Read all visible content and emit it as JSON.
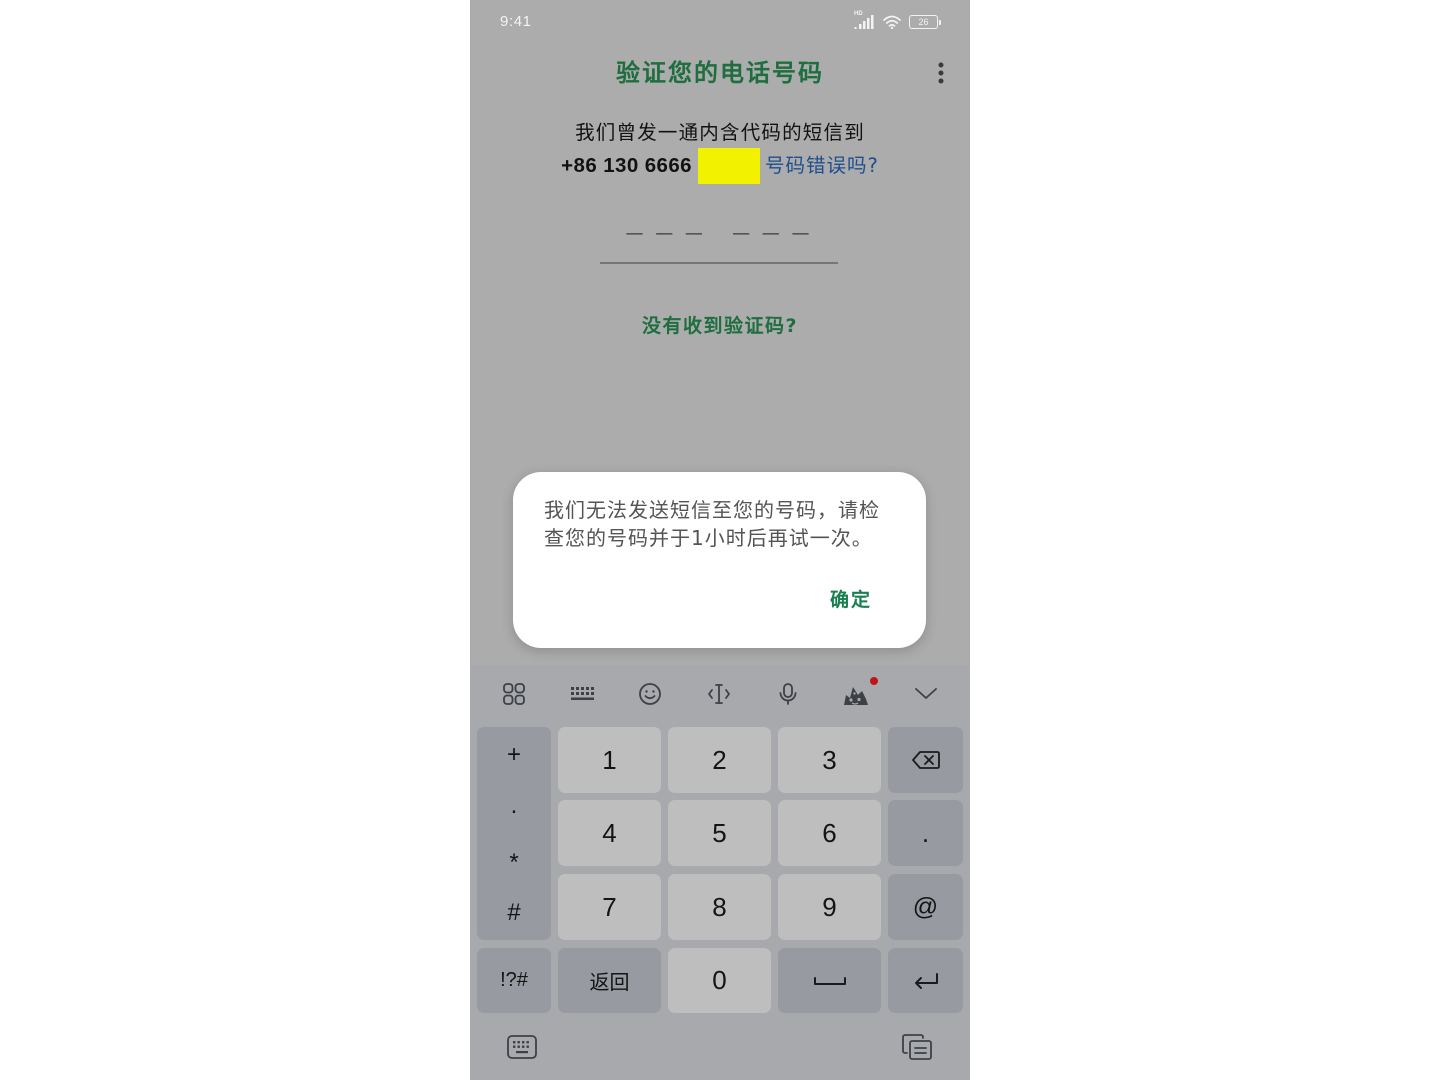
{
  "status_bar": {
    "time": "9:41",
    "network_label": "HD",
    "battery_level": "26",
    "icons": [
      "signal-icon",
      "wifi-icon",
      "battery-icon"
    ]
  },
  "header": {
    "title": "验证您的电话号码",
    "menu_icon": "more-vert-icon"
  },
  "verification": {
    "instruction": "我们曾发一通内含代码的短信到",
    "phone_number": "+86 130 6666",
    "wrong_number_link": "号码错误吗?",
    "code_placeholder": "— — —   — — —",
    "resend_link": "没有收到验证码?"
  },
  "dialog": {
    "message": "我们无法发送短信至您的号码，请检查您的号码并于1小时后再试一次。",
    "ok_label": "确定"
  },
  "keyboard": {
    "toolbar_icons": [
      "apps-grid-icon",
      "keyboard-layout-icon",
      "emoji-icon",
      "text-cursor-icon",
      "microphone-icon",
      "stickers-icon",
      "chevron-down-icon"
    ],
    "side_symbols": [
      "+",
      ".",
      "*",
      "#"
    ],
    "symbols_key": "!?#",
    "digits": [
      "1",
      "2",
      "3",
      "4",
      "5",
      "6",
      "7",
      "8",
      "9",
      "0"
    ],
    "period_key": ".",
    "at_key": "@",
    "back_key": "返回",
    "function_icons": [
      "backspace-icon",
      "space-bar-icon",
      "enter-icon"
    ],
    "bottom_icons": [
      "keyboard-switch-icon",
      "clipboard-icon"
    ]
  },
  "colors": {
    "accent": "#1e6e40",
    "dialog_accent": "#18804f",
    "link_blue": "#1d4f8f",
    "redaction_yellow": "#f2f200",
    "notification_red": "#c0141a"
  }
}
